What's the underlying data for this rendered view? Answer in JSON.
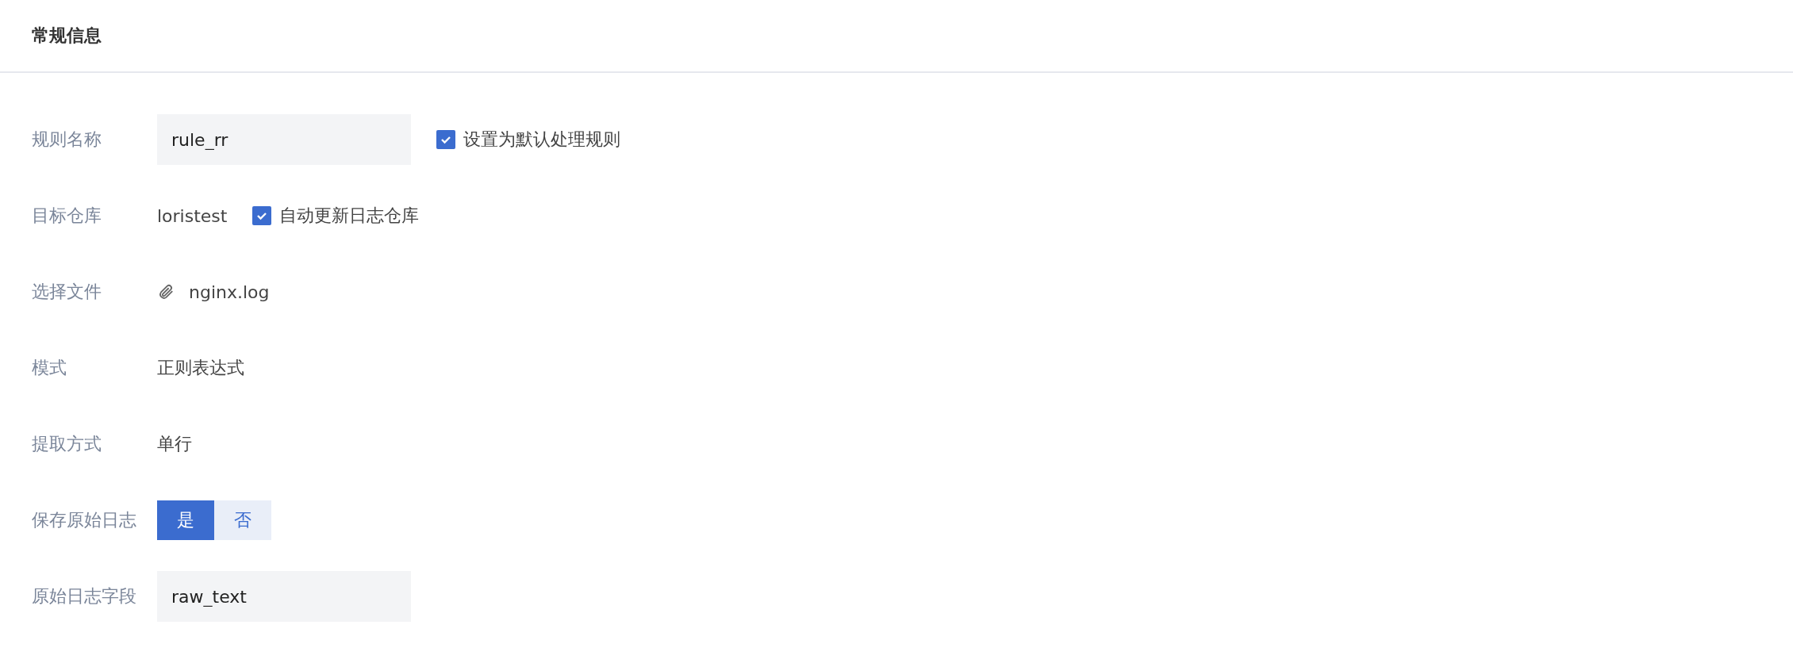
{
  "section_title": "常规信息",
  "fields": [
    {
      "kind": "input",
      "label": "规则名称",
      "value": "rule_rr",
      "checkbox": {
        "label": "设置为默认处理规则",
        "checked": true
      }
    },
    {
      "kind": "text",
      "label": "目标仓库",
      "value": "loristest",
      "checkbox": {
        "label": "自动更新日志仓库",
        "checked": true
      }
    },
    {
      "kind": "file",
      "label": "选择文件",
      "value": "nginx.log"
    },
    {
      "kind": "text",
      "label": "模式",
      "value": "正则表达式"
    },
    {
      "kind": "text",
      "label": "提取方式",
      "value": "单行"
    },
    {
      "kind": "toggle",
      "label": "保存原始日志",
      "options": [
        {
          "label": "是",
          "selected": true
        },
        {
          "label": "否",
          "selected": false
        }
      ]
    },
    {
      "kind": "input",
      "label": "原始日志字段",
      "value": "raw_text"
    }
  ]
}
